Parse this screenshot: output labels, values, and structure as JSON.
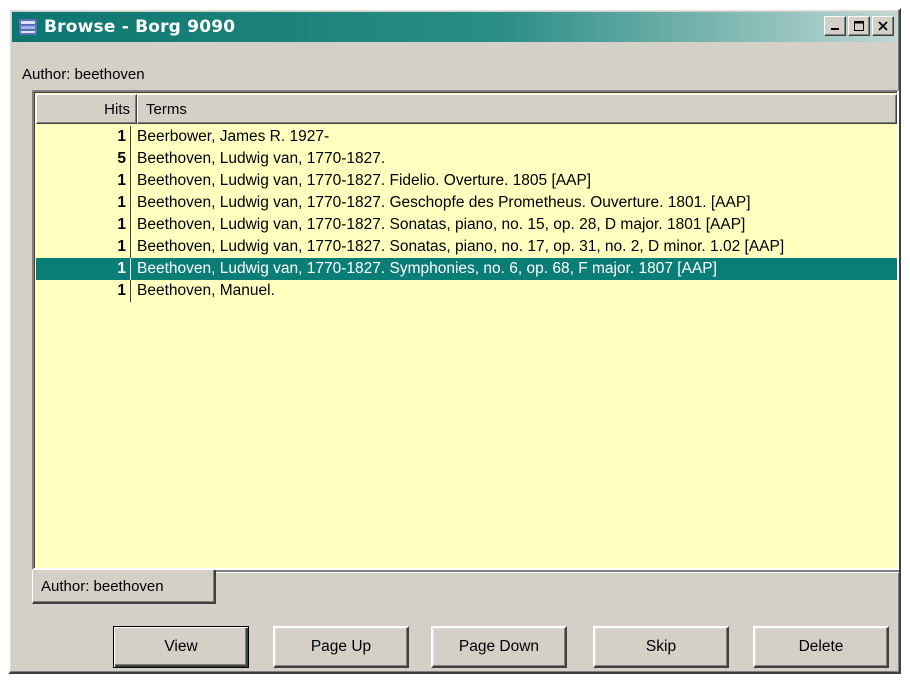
{
  "window": {
    "title": "Browse - Borg 9090",
    "controls": {
      "minimize": "minimize",
      "maximize": "maximize",
      "close": "close"
    }
  },
  "author_line": "Author: beethoven",
  "list": {
    "columns": {
      "hits": "Hits",
      "terms": "Terms"
    },
    "rows": [
      {
        "hits": "1",
        "term": "Beerbower, James R. 1927-",
        "selected": false
      },
      {
        "hits": "5",
        "term": "Beethoven, Ludwig van, 1770-1827.",
        "selected": false
      },
      {
        "hits": "1",
        "term": "Beethoven, Ludwig van, 1770-1827. Fidelio. Overture. 1805 [AAP]",
        "selected": false
      },
      {
        "hits": "1",
        "term": "Beethoven, Ludwig van, 1770-1827. Geschopfe des Prometheus. Ouverture. 1801. [AAP]",
        "selected": false
      },
      {
        "hits": "1",
        "term": "Beethoven, Ludwig van, 1770-1827. Sonatas, piano, no. 15, op. 28, D major. 1801 [AAP]",
        "selected": false
      },
      {
        "hits": "1",
        "term": "Beethoven, Ludwig van, 1770-1827. Sonatas, piano, no. 17, op. 31, no. 2, D minor. 1.02 [AAP]",
        "selected": false
      },
      {
        "hits": "1",
        "term": "Beethoven, Ludwig van, 1770-1827. Symphonies, no. 6, op. 68, F major. 1807 [AAP]",
        "selected": true
      },
      {
        "hits": "1",
        "term": "Beethoven, Manuel.",
        "selected": false
      }
    ]
  },
  "tab": {
    "label": "Author: beethoven"
  },
  "buttons": {
    "view": "View",
    "page_up": "Page Up",
    "page_down": "Page Down",
    "skip": "Skip",
    "delete": "Delete"
  },
  "colors": {
    "titlebar": "#0a766f",
    "list_background": "#ffffc0",
    "selection": "#0b7d77",
    "chrome": "#d4d0c8"
  },
  "icons": {
    "app": "book-stack-icon",
    "minimize": "minimize-icon",
    "maximize": "maximize-icon",
    "close": "close-icon"
  }
}
